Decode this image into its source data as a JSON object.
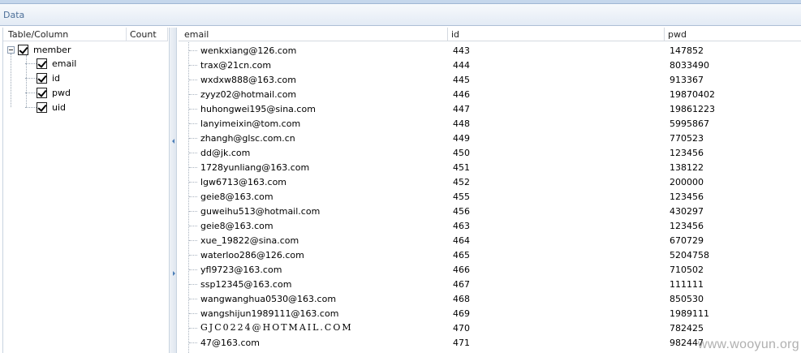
{
  "panel": {
    "title": "Data"
  },
  "tree": {
    "columns": [
      "Table/Column",
      "Count"
    ],
    "table": {
      "label": "member",
      "checked": true
    },
    "fields": [
      {
        "label": "email",
        "checked": true
      },
      {
        "label": "id",
        "checked": true
      },
      {
        "label": "pwd",
        "checked": true
      },
      {
        "label": "uid",
        "checked": true
      }
    ]
  },
  "grid": {
    "columns": [
      "email",
      "id",
      "pwd"
    ],
    "rows": [
      {
        "email": "wenkxiang@126.com",
        "id": "443",
        "pwd": "147852"
      },
      {
        "email": "trax@21cn.com",
        "id": "444",
        "pwd": "8033490"
      },
      {
        "email": "wxdxw888@163.com",
        "id": "445",
        "pwd": "913367"
      },
      {
        "email": "zyyz02@hotmail.com",
        "id": "446",
        "pwd": "19870402"
      },
      {
        "email": "huhongwei195@sina.com",
        "id": "447",
        "pwd": "19861223"
      },
      {
        "email": "lanyimeixin@tom.com",
        "id": "448",
        "pwd": "5995867"
      },
      {
        "email": "zhangh@glsc.com.cn",
        "id": "449",
        "pwd": "770523"
      },
      {
        "email": "dd@jk.com",
        "id": "450",
        "pwd": "123456"
      },
      {
        "email": "1728yunliang@163.com",
        "id": "451",
        "pwd": "138122"
      },
      {
        "email": "lgw6713@163.com",
        "id": "452",
        "pwd": "200000"
      },
      {
        "email": "geie8@163.com",
        "id": "455",
        "pwd": "123456"
      },
      {
        "email": "guweihu513@hotmail.com",
        "id": "456",
        "pwd": "430297"
      },
      {
        "email": "geie8@163.com",
        "id": "463",
        "pwd": "123456"
      },
      {
        "email": "xue_19822@sina.com",
        "id": "464",
        "pwd": "670729"
      },
      {
        "email": "waterloo286@126.com",
        "id": "465",
        "pwd": "5204758"
      },
      {
        "email": "yfl9723@163.com",
        "id": "466",
        "pwd": "710502"
      },
      {
        "email": "ssp12345@163.com",
        "id": "467",
        "pwd": "111111"
      },
      {
        "email": "wangwanghua0530@163.com",
        "id": "468",
        "pwd": "850530"
      },
      {
        "email": "wangshijun1989111@163.com",
        "id": "469",
        "pwd": "1989111"
      },
      {
        "email": "GJC0224@HOTMAIL.COM",
        "id": "470",
        "pwd": "782425"
      },
      {
        "email": "47@163.com",
        "id": "471",
        "pwd": "982447"
      }
    ]
  },
  "watermark": "www.wooyun.org"
}
